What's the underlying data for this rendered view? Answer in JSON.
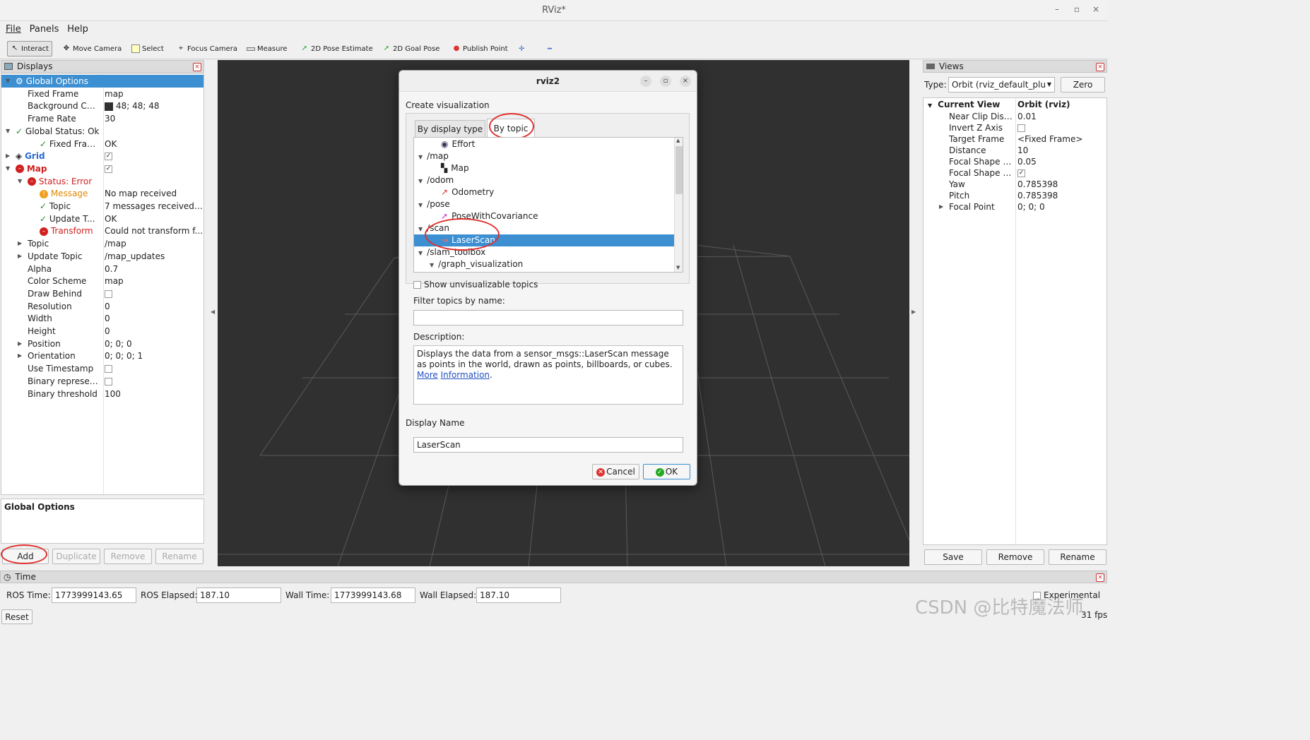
{
  "window": {
    "title": "RViz*",
    "min": "–",
    "max": "▫",
    "close": "×"
  },
  "menu": {
    "file": "File",
    "panels": "Panels",
    "help": "Help"
  },
  "toolbar": {
    "interact": "Interact",
    "move_camera": "Move Camera",
    "select": "Select",
    "focus_camera": "Focus Camera",
    "measure": "Measure",
    "pose_estimate": "2D Pose Estimate",
    "goal_pose": "2D Goal Pose",
    "publish_point": "Publish Point",
    "plus": "✛",
    "minus": "━"
  },
  "displays": {
    "title": "Displays",
    "rows": [
      {
        "key": "Global Options",
        "value": ""
      },
      {
        "key": "Fixed Frame",
        "value": "map"
      },
      {
        "key": "Background Color",
        "value": "48; 48; 48"
      },
      {
        "key": "Frame Rate",
        "value": "30"
      },
      {
        "key": "Global Status: Ok",
        "value": ""
      },
      {
        "key": "Fixed Frame",
        "value": "OK"
      },
      {
        "key": "Grid",
        "value": "✓"
      },
      {
        "key": "Map",
        "value": "✓"
      },
      {
        "key": "Status: Error",
        "value": ""
      },
      {
        "key": "Message",
        "value": "No map received"
      },
      {
        "key": "Topic",
        "value": "7 messages received a..."
      },
      {
        "key": "Update T...",
        "value": "OK"
      },
      {
        "key": "Transform",
        "value": "Could not transform f..."
      },
      {
        "key": "Topic",
        "value": "/map"
      },
      {
        "key": "Update Topic",
        "value": "/map_updates"
      },
      {
        "key": "Alpha",
        "value": "0.7"
      },
      {
        "key": "Color Scheme",
        "value": "map"
      },
      {
        "key": "Draw Behind",
        "value": ""
      },
      {
        "key": "Resolution",
        "value": "0"
      },
      {
        "key": "Width",
        "value": "0"
      },
      {
        "key": "Height",
        "value": "0"
      },
      {
        "key": "Position",
        "value": "0; 0; 0"
      },
      {
        "key": "Orientation",
        "value": "0; 0; 0; 1"
      },
      {
        "key": "Use Timestamp",
        "value": ""
      },
      {
        "key": "Binary represen...",
        "value": ""
      },
      {
        "key": "Binary threshold",
        "value": "100"
      }
    ],
    "description_title": "Global Options",
    "buttons": {
      "add": "Add",
      "duplicate": "Duplicate",
      "remove": "Remove",
      "rename": "Rename"
    }
  },
  "dialog": {
    "title": "rviz2",
    "heading": "Create visualization",
    "tabs": [
      "By display type",
      "By topic"
    ],
    "topics": [
      {
        "label": "Effort"
      },
      {
        "label": "/map"
      },
      {
        "label": "Map"
      },
      {
        "label": "/odom"
      },
      {
        "label": "Odometry"
      },
      {
        "label": "/pose"
      },
      {
        "label": "PoseWithCovariance"
      },
      {
        "label": "/scan"
      },
      {
        "label": "LaserScan"
      },
      {
        "label": "/slam_toolbox"
      },
      {
        "label": "/graph_visualization"
      }
    ],
    "show_unvisualizable": "Show unvisualizable topics",
    "filter_label": "Filter topics by name:",
    "filter_value": "",
    "description_label": "Description:",
    "description_text": "Displays the data from a sensor_msgs::LaserScan message as points in the world, drawn as points, billboards, or cubes.",
    "more_info_1": "More",
    "more_info_2": "Information",
    "period": ".",
    "display_name_label": "Display Name",
    "display_name_value": "LaserScan",
    "cancel": "Cancel",
    "ok": "OK"
  },
  "views": {
    "title": "Views",
    "type_label": "Type:",
    "type_value": "Orbit (rviz_default_plu",
    "zero": "Zero",
    "header_key": "Current View",
    "header_value": "Orbit (rviz)",
    "rows": [
      {
        "key": "Near Clip Dist...",
        "value": "0.01"
      },
      {
        "key": "Invert Z Axis",
        "value": ""
      },
      {
        "key": "Target Frame",
        "value": "<Fixed Frame>"
      },
      {
        "key": "Distance",
        "value": "10"
      },
      {
        "key": "Focal Shape S...",
        "value": "0.05"
      },
      {
        "key": "Focal Shape F...",
        "value": "✓"
      },
      {
        "key": "Yaw",
        "value": "0.785398"
      },
      {
        "key": "Pitch",
        "value": "0.785398"
      },
      {
        "key": "Focal Point",
        "value": "0; 0; 0"
      }
    ],
    "buttons": {
      "save": "Save",
      "remove": "Remove",
      "rename": "Rename"
    }
  },
  "time": {
    "title": "Time",
    "ros_time_label": "ROS Time:",
    "ros_time": "1773999143.65",
    "ros_elapsed_label": "ROS Elapsed:",
    "ros_elapsed": "187.10",
    "wall_time_label": "Wall Time:",
    "wall_time": "1773999143.68",
    "wall_elapsed_label": "Wall Elapsed:",
    "wall_elapsed": "187.10",
    "experimental": "Experimental",
    "reset": "Reset",
    "fps": "31 fps"
  },
  "watermark": "CSDN @比特魔法师",
  "colors": {
    "accent": "#3c8fd1",
    "error": "#d02020",
    "viewport": "#303030"
  }
}
